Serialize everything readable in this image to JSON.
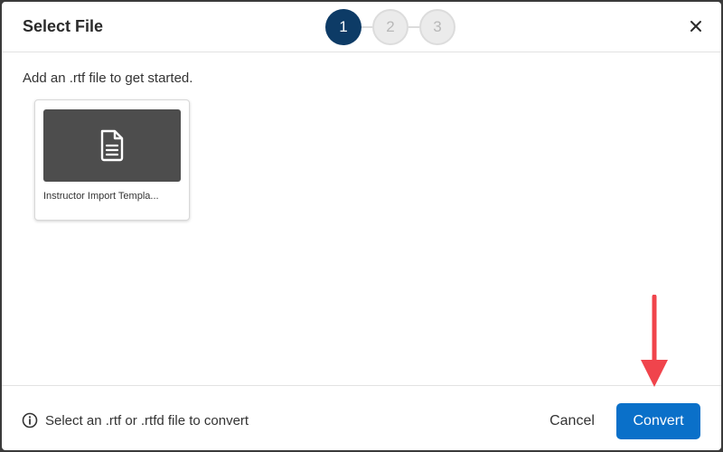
{
  "dialog": {
    "title": "Select File",
    "close_icon": "close-icon"
  },
  "stepper": {
    "steps": [
      {
        "label": "1",
        "state": "active"
      },
      {
        "label": "2",
        "state": "inactive"
      },
      {
        "label": "3",
        "state": "inactive"
      }
    ]
  },
  "main": {
    "instruction": "Add an .rtf file to get started.",
    "files": [
      {
        "name": "Instructor Import Templa...",
        "icon": "document-icon"
      }
    ]
  },
  "footer": {
    "hint_icon": "info-icon",
    "hint": "Select an .rtf or .rtfd file to convert",
    "cancel_label": "Cancel",
    "convert_label": "Convert"
  },
  "colors": {
    "accent": "#0a70c9",
    "step_active": "#0d3b66",
    "annotation_arrow": "#f0444c"
  }
}
